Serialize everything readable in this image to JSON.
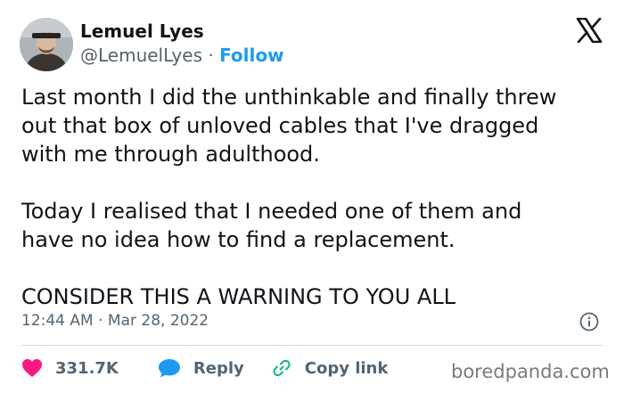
{
  "author": {
    "name": "Lemuel Lyes",
    "handle": "@LemuelLyes",
    "separator": "·",
    "follow_label": "Follow"
  },
  "tweet": {
    "paragraphs": [
      [
        "Last month I did the unthinkable and finally threw",
        "out that box of unloved cables that I've dragged",
        "with me through adulthood."
      ],
      [
        "Today I realised that I needed one of them and",
        "have no idea how to find a replacement."
      ],
      [
        "CONSIDER THIS A WARNING TO YOU ALL"
      ]
    ],
    "time": "12:44 AM",
    "meta_separator": "·",
    "date": "Mar 28, 2022"
  },
  "actions": {
    "like_count": "331.7K",
    "reply_label": "Reply",
    "copy_link_label": "Copy link"
  },
  "watermark": "boredpanda.com",
  "icons": {
    "platform_logo": "x-logo-icon",
    "info": "info-icon",
    "like": "heart-icon",
    "reply": "speech-bubble-icon",
    "copy_link": "link-icon"
  },
  "colors": {
    "follow": "#1d9bf0",
    "like": "#f91880",
    "reply": "#1d9bf0",
    "copy_link": "#00ba7c",
    "muted": "#536471",
    "text": "#0f1419"
  }
}
